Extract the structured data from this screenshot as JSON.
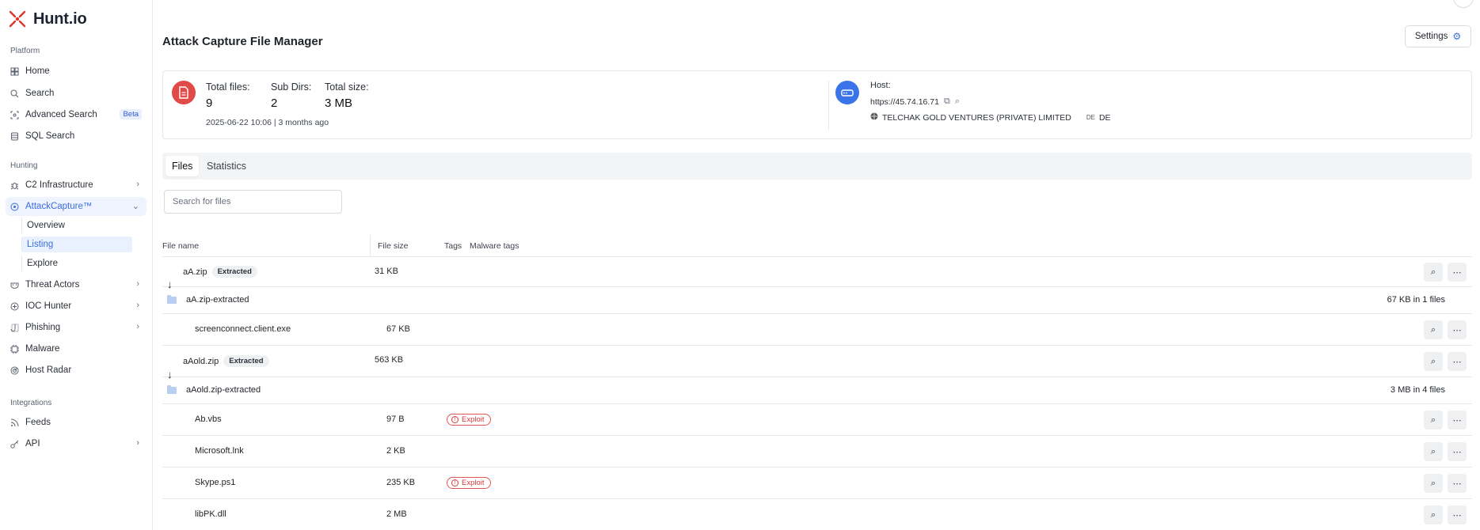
{
  "brand": {
    "name": "Hunt.io",
    "accent": "#d9352f"
  },
  "sidebar": {
    "sections": [
      {
        "label": "Platform"
      },
      {
        "label": "Hunting"
      },
      {
        "label": "Integrations"
      }
    ],
    "items": [
      {
        "label": "Home",
        "icon": "home-icon"
      },
      {
        "label": "Search",
        "icon": "search-icon"
      },
      {
        "label": "Advanced Search",
        "icon": "scan-icon",
        "badge": "Beta"
      },
      {
        "label": "SQL Search",
        "icon": "database-icon"
      },
      {
        "label": "C2 Infrastructure",
        "icon": "bug-icon"
      },
      {
        "label": "AttackCapture™",
        "icon": "capture-icon"
      },
      {
        "label": "Threat Actors",
        "icon": "mask-icon"
      },
      {
        "label": "IOC Hunter",
        "icon": "target-icon"
      },
      {
        "label": "Phishing",
        "icon": "hook-icon"
      },
      {
        "label": "Malware",
        "icon": "malware-icon"
      },
      {
        "label": "Host Radar",
        "icon": "radar-icon"
      },
      {
        "label": "Feeds",
        "icon": "rss-icon"
      },
      {
        "label": "API",
        "icon": "key-icon"
      }
    ],
    "subitems": [
      {
        "label": "Overview"
      },
      {
        "label": "Listing"
      },
      {
        "label": "Explore"
      }
    ]
  },
  "header": {
    "title": "Attack Capture File Manager",
    "settings_label": "Settings"
  },
  "summary": {
    "total_files_label": "Total files:",
    "total_files": "9",
    "sub_dirs_label": "Sub Dirs:",
    "sub_dirs": "2",
    "total_size_label": "Total size:",
    "total_size": "3 MB",
    "date": "2025-06-22 10:06 | 3 months ago",
    "host_label": "Host:",
    "host_url": "https://45.74.16.71",
    "host_org": "TELCHAK GOLD VENTURES (PRIVATE) LIMITED",
    "country_flag": "DE",
    "country": "DE"
  },
  "tabs": [
    {
      "label": "Files"
    },
    {
      "label": "Statistics"
    }
  ],
  "search": {
    "placeholder": "Search for files"
  },
  "table": {
    "headers": [
      "File name",
      "File size",
      "Tags",
      "Malware tags"
    ],
    "rows": [
      {
        "name": "aA.zip",
        "badge": "Extracted",
        "size": "31 KB"
      },
      {
        "name": "aA.zip-extracted",
        "summary": "67 KB in 1 files"
      },
      {
        "name": "screenconnect.client.exe",
        "size": "67 KB"
      },
      {
        "name": "aAold.zip",
        "badge": "Extracted",
        "size": "563 KB"
      },
      {
        "name": "aAold.zip-extracted",
        "summary": "3 MB in 4 files"
      },
      {
        "name": "Ab.vbs",
        "size": "97 B",
        "tag": "Exploit"
      },
      {
        "name": "Microsoft.lnk",
        "size": "2 KB"
      },
      {
        "name": "Skype.ps1",
        "size": "235 KB",
        "tag": "Exploit"
      },
      {
        "name": "libPK.dll",
        "size": "2 MB"
      }
    ]
  },
  "colors": {
    "accent_blue": "#3a6de0",
    "exploit_red": "#d93a3a"
  }
}
